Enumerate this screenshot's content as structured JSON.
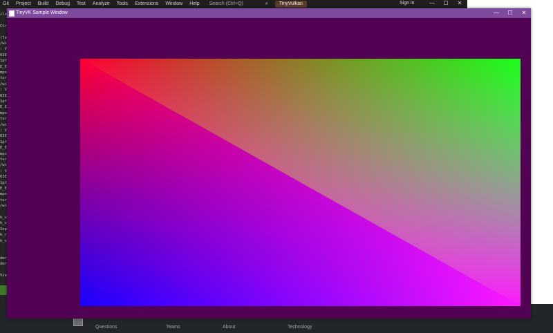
{
  "ide": {
    "menu_items": [
      "Git",
      "Project",
      "Build",
      "Debug",
      "Test",
      "Analyze",
      "Tools",
      "Extensions",
      "Window",
      "Help"
    ],
    "search_placeholder": "Search (Ctrl+Q)",
    "project_name": "TinyVulkan",
    "sign_in": "Sign in",
    "gutter_lines": [
      "ilo",
      "",
      "Ctrl",
      "",
      "(Te",
      "/wi",
      ": V",
      "63E",
      "1pf",
      "E_E",
      "mpo",
      "tur",
      "/wi",
      ": V",
      "63E",
      "1pf",
      "E_E",
      "mpo",
      "tur",
      "/wi",
      ": V",
      "63E",
      "1pf",
      "E_E",
      "mpo",
      "tur",
      "/wi",
      ": V",
      "63E",
      "1pf",
      "E_E",
      "mpo",
      "tur",
      "/wi",
      "",
      "k_v",
      "k_v",
      "Inp",
      "k_r",
      "k_v",
      "",
      "",
      "der",
      "der",
      "",
      "View"
    ]
  },
  "window": {
    "title": "TinyVK Sample Window",
    "minimize_glyph": "—",
    "maximize_glyph": "☐",
    "close_glyph": "✕",
    "background_color": "#510253"
  },
  "render": {
    "corner_colors": {
      "top_left": "#ff0032",
      "top_right": "#19ff19",
      "bottom_left": "#1900ff",
      "bottom_right": "#ff19ff",
      "upper_mid": "#ff80ff",
      "lower_mid": "#ff00ff"
    }
  },
  "footer": {
    "links": [
      "Questions",
      "Teams",
      "About",
      "Technology"
    ]
  }
}
